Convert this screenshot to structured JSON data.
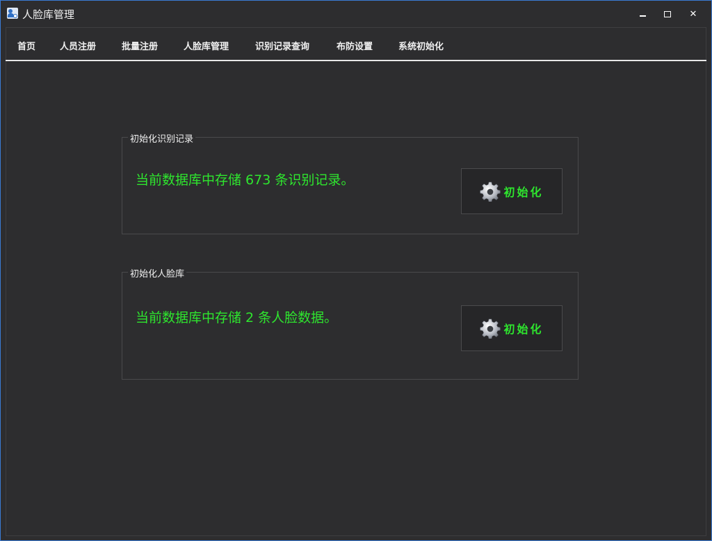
{
  "window": {
    "title": "人脸库管理"
  },
  "tabs": [
    {
      "label": "首页"
    },
    {
      "label": "人员注册"
    },
    {
      "label": "批量注册"
    },
    {
      "label": "人脸库管理"
    },
    {
      "label": "识别记录查询"
    },
    {
      "label": "布防设置"
    },
    {
      "label": "系统初始化"
    }
  ],
  "init_records": {
    "group_title": "初始化识别记录",
    "message": "当前数据库中存储 673 条识别记录。",
    "button_label": "初始化"
  },
  "init_faces": {
    "group_title": "初始化人脸库",
    "message": "当前数据库中存储 2 条人脸数据。",
    "button_label": "初始化"
  },
  "icons": {
    "app": "face-db-app-icon",
    "minimize": "minimize-icon",
    "maximize": "maximize-icon",
    "close": "close-icon",
    "init": "gear-icon"
  },
  "colors": {
    "background": "#2d2d2f",
    "accent_green": "#2ee62e",
    "border": "#4a4a4c"
  }
}
